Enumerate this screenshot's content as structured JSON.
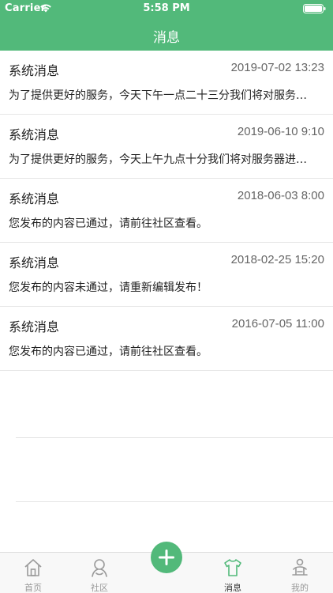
{
  "status_bar": {
    "carrier": "Carrier",
    "time": "5:58 PM"
  },
  "header": {
    "title": "消息"
  },
  "messages": [
    {
      "title": "系统消息",
      "time": "2019-07-02 13:23",
      "body": "为了提供更好的服务，今天下午一点二十三分我们将对服务器进行维护"
    },
    {
      "title": "系统消息",
      "time": "2019-06-10 9:10",
      "body": "为了提供更好的服务，今天上午九点十分我们将对服务器进行维护"
    },
    {
      "title": "系统消息",
      "time": "2018-06-03 8:00",
      "body": "您发布的内容已通过，请前往社区查看。"
    },
    {
      "title": "系统消息",
      "time": "2018-02-25 15:20",
      "body": "您发布的内容未通过，请重新编辑发布！"
    },
    {
      "title": "系统消息",
      "time": "2016-07-05 11:00",
      "body": "您发布的内容已通过，请前往社区查看。"
    }
  ],
  "tabbar": {
    "home": "首页",
    "community": "社区",
    "messages": "消息",
    "mine": "我的"
  },
  "colors": {
    "accent": "#52b97a",
    "tab_inactive": "#999999",
    "tab_active": "#333333"
  }
}
